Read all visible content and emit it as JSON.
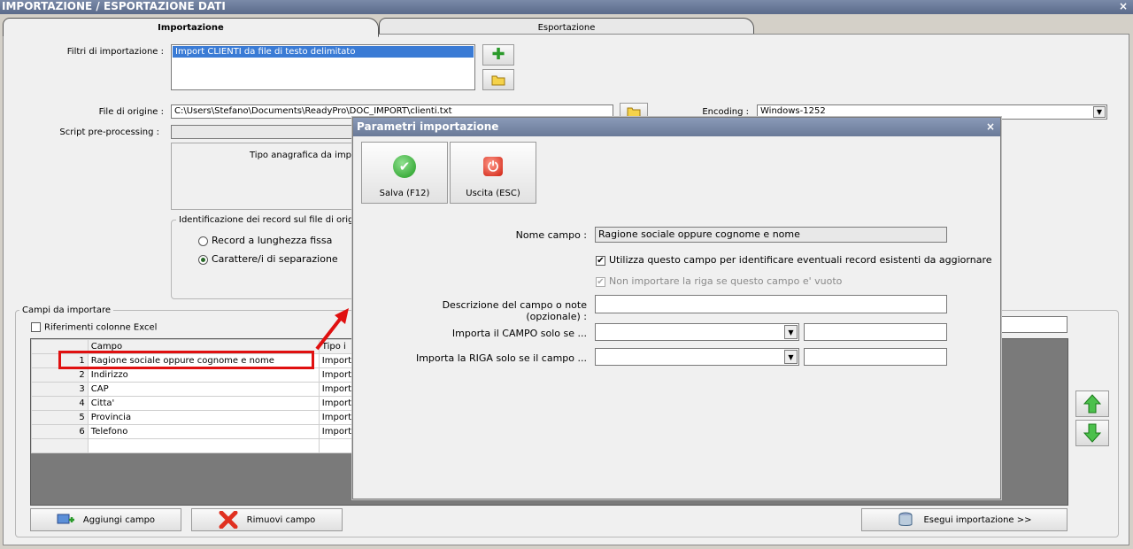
{
  "window": {
    "title": "IMPORTAZIONE / ESPORTAZIONE DATI",
    "close": "×"
  },
  "tabs": [
    {
      "label": "Importazione"
    },
    {
      "label": "Esportazione"
    }
  ],
  "filters": {
    "label": "Filtri di importazione :",
    "items": [
      "Import CLIENTI da file di testo delimitato"
    ]
  },
  "source_file": {
    "label": "File di origine :",
    "value": "C:\\Users\\Stefano\\Documents\\ReadyPro\\DOC_IMPORT\\clienti.txt"
  },
  "encoding": {
    "label": "Encoding :",
    "value": "Windows-1252"
  },
  "script": {
    "label": "Script pre-processing :"
  },
  "tipo_anagrafica": {
    "label": "Tipo anagrafica da importa"
  },
  "record_id_group": {
    "title": "Identificazione dei record sul file di origine",
    "options": [
      "Record a lunghezza fissa",
      "Carattere/i di separazione"
    ],
    "selected": 1
  },
  "fields_group": {
    "title": "Campi da importare",
    "excel_refs_label": "Riferimenti colonne Excel",
    "columns": [
      "Campo",
      "Tipo i"
    ],
    "rows": [
      {
        "n": "1",
        "campo": "Ragione sociale oppure cognome e nome",
        "tipo": "Import"
      },
      {
        "n": "2",
        "campo": "Indirizzo",
        "tipo": "Import"
      },
      {
        "n": "3",
        "campo": "CAP",
        "tipo": "Import"
      },
      {
        "n": "4",
        "campo": "Citta'",
        "tipo": "Import"
      },
      {
        "n": "5",
        "campo": "Provincia",
        "tipo": "Import"
      },
      {
        "n": "6",
        "campo": "Telefono",
        "tipo": "Import"
      }
    ]
  },
  "buttons": {
    "add_field": "Aggiungi campo",
    "remove_field": "Rimuovi campo",
    "run_import": "Esegui importazione >>"
  },
  "dialog": {
    "title": "Parametri importazione",
    "close": "×",
    "save_label": "Salva (F12)",
    "exit_label": "Uscita (ESC)",
    "field_name_label": "Nome campo :",
    "field_name_value": "Ragione sociale oppure cognome e nome",
    "identify_label": "Utilizza questo campo per identificare eventuali record esistenti da aggiornare",
    "skip_empty_label": "Non importare la riga se questo campo e' vuoto",
    "description_label": "Descrizione del campo o note (opzionale) :",
    "import_field_if_label": "Importa il CAMPO solo se ...",
    "import_row_if_label": "Importa la RIGA solo se il campo ..."
  },
  "colors": {
    "highlight": "#e01010",
    "selection": "#3a7bd5"
  }
}
